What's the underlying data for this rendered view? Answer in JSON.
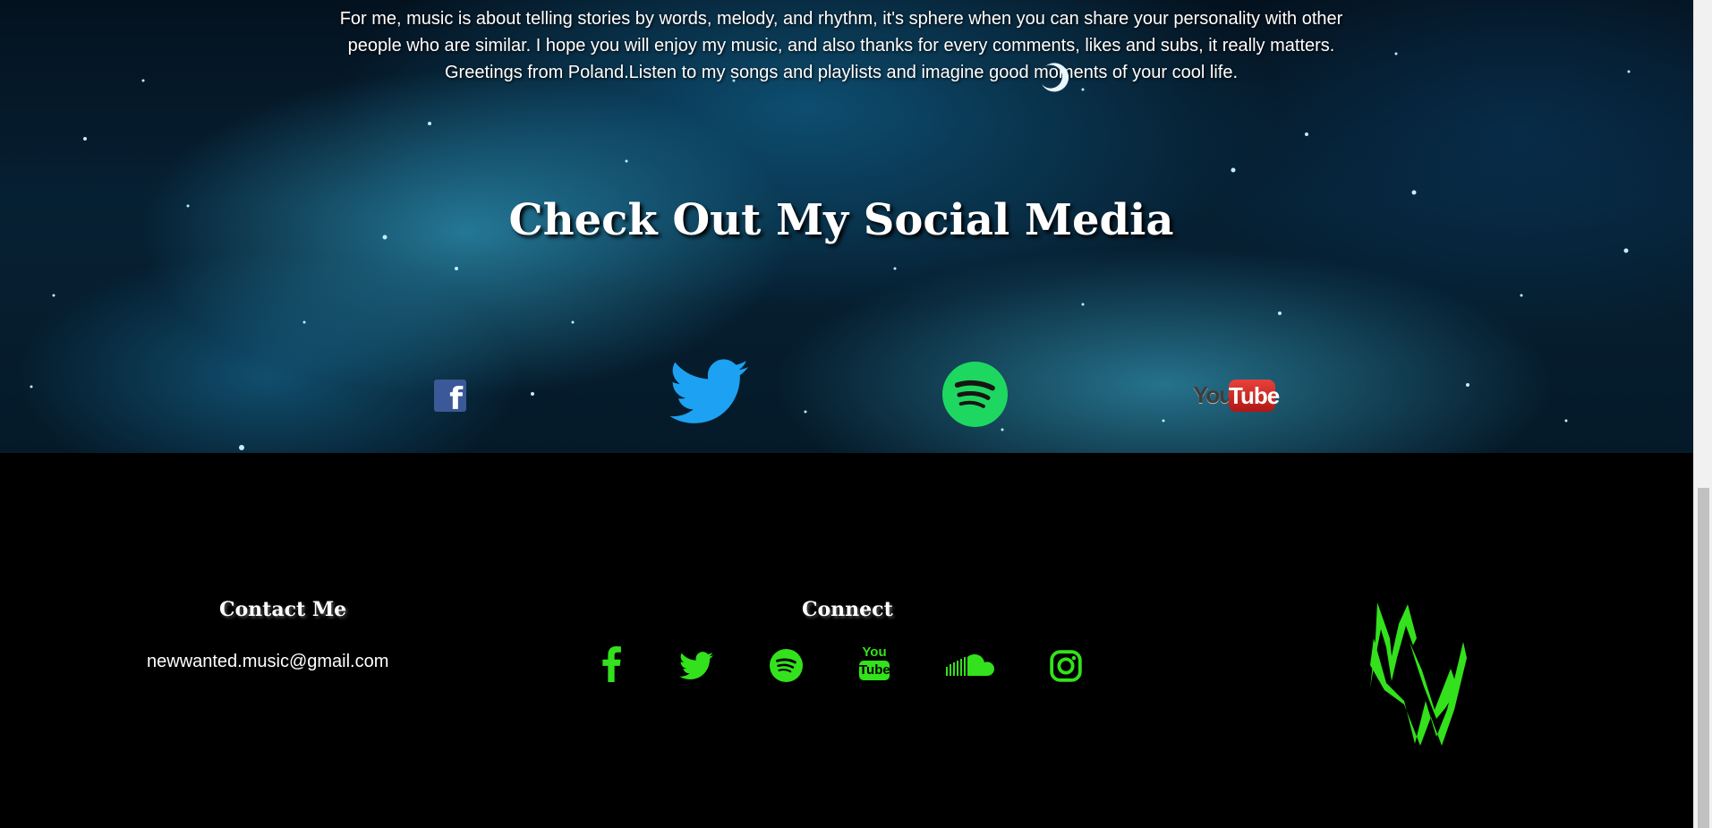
{
  "hero": {
    "intro_text": "For me, music is about telling stories by words, melody, and rhythm, it's sphere when you can share your personality with other people who are similar. I hope you will enjoy my music, and also thanks for every comments, likes and subs, it really matters. Greetings from Poland.Listen to my songs and playlists and imagine good moments of your cool life.",
    "title": "Check Out My Social Media",
    "social_links": [
      {
        "icon": "facebook-icon"
      },
      {
        "icon": "twitter-icon"
      },
      {
        "icon": "spotify-icon"
      },
      {
        "icon": "youtube-icon",
        "label_you": "You",
        "label_tube": "Tube"
      }
    ]
  },
  "footer": {
    "contact_heading": "Contact Me",
    "email": "newwanted.music@gmail.com",
    "connect_heading": "Connect",
    "connect_icons": [
      "facebook-icon",
      "twitter-icon",
      "spotify-icon",
      "youtube-icon",
      "soundcloud-icon",
      "instagram-icon"
    ],
    "youtube_small": {
      "you": "You",
      "tube": "Tube"
    },
    "accent_color": "#33e11c",
    "logo_name": "nw-logo"
  }
}
